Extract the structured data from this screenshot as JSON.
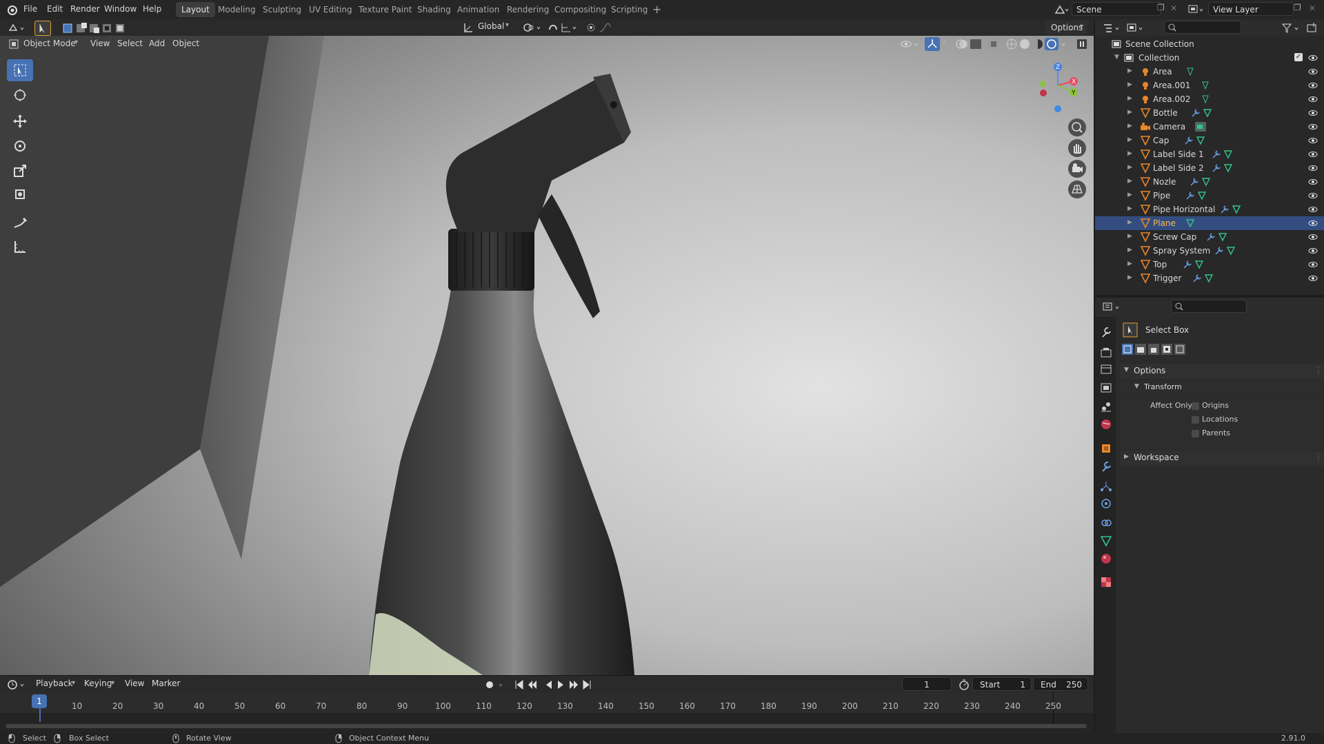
{
  "menu": [
    "File",
    "Edit",
    "Render",
    "Window",
    "Help"
  ],
  "workspaces": [
    "Layout",
    "Modeling",
    "Sculpting",
    "UV Editing",
    "Texture Paint",
    "Shading",
    "Animation",
    "Rendering",
    "Compositing",
    "Scripting"
  ],
  "active_workspace": "Layout",
  "scene_name": "Scene",
  "view_layer": "View Layer",
  "header": {
    "mode": "Object Mode",
    "menus": [
      "View",
      "Select",
      "Add",
      "Object"
    ],
    "transform_orientation": "Global",
    "options": "Options"
  },
  "outliner": {
    "root": "Scene Collection",
    "collection": "Collection",
    "objects": [
      "Area",
      "Area.001",
      "Area.002",
      "Bottle",
      "Camera",
      "Cap",
      "Label Side 1",
      "Label Side 2",
      "Nozle",
      "Pipe",
      "Pipe Horizontal",
      "Plane",
      "Screw Cap",
      "Spray System",
      "Top",
      "Trigger"
    ],
    "selected": "Plane"
  },
  "properties": {
    "tool": "Select Box",
    "options_panel": "Options",
    "transform_panel": "Transform",
    "affect_only": "Affect Only",
    "checks": [
      "Origins",
      "Locations",
      "Parents"
    ],
    "workspace_panel": "Workspace"
  },
  "timeline": {
    "menus": [
      "Playback",
      "Keying",
      "View",
      "Marker"
    ],
    "current_frame": "1",
    "start_label": "Start",
    "start": "1",
    "end_label": "End",
    "end": "250",
    "ticks": [
      "10",
      "20",
      "30",
      "40",
      "50",
      "60",
      "70",
      "80",
      "90",
      "100",
      "110",
      "120",
      "130",
      "140",
      "150",
      "160",
      "170",
      "180",
      "190",
      "200",
      "210",
      "220",
      "230",
      "240",
      "250"
    ],
    "playhead_label": "1"
  },
  "statusbar": {
    "select": "Select",
    "box_select": "Box Select",
    "rotate": "Rotate View",
    "context": "Object Context Menu",
    "version": "2.91.0"
  },
  "colors": {
    "accent": "#4772b3",
    "selected_row": "#334d80",
    "selected_text": "#ffb84d",
    "mesh_icon": "#e8862a",
    "modifier_icon": "#6da0e8",
    "data_icon": "#31c48d"
  }
}
